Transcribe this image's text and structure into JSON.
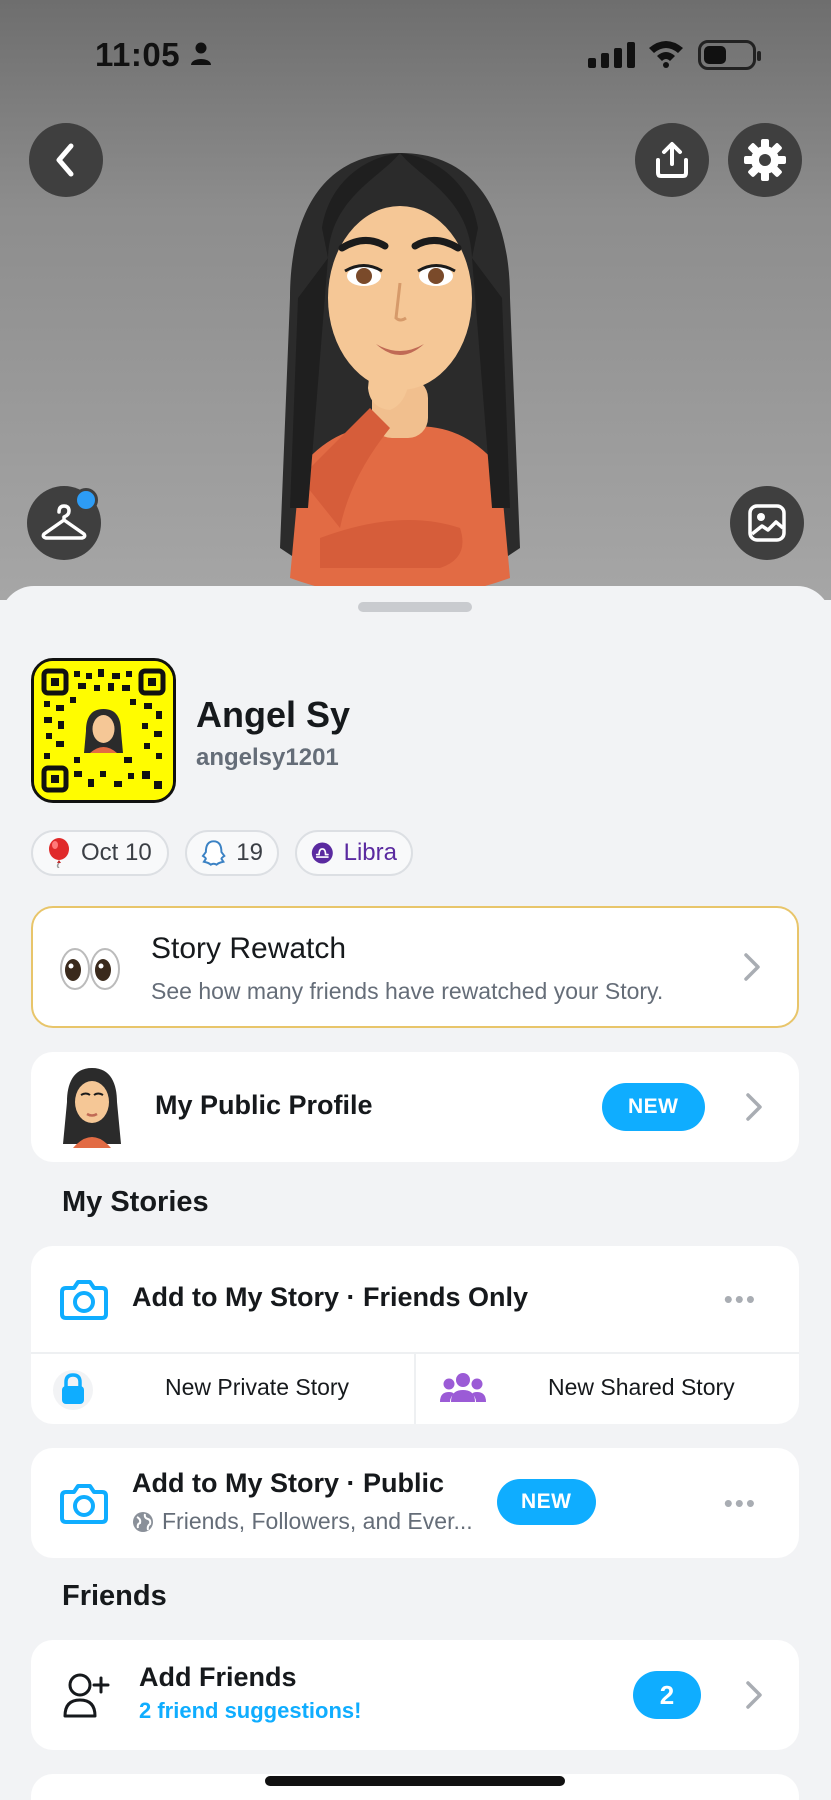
{
  "status_bar": {
    "time": "11:05"
  },
  "profile": {
    "name": "Angel Sy",
    "username": "angelsy1201"
  },
  "chips": {
    "birthday": "Oct 10",
    "snap_score": "19",
    "zodiac": "Libra"
  },
  "story_rewatch": {
    "title": "Story Rewatch",
    "subtitle": "See how many friends have rewatched your Story."
  },
  "public_profile": {
    "label": "My Public Profile",
    "badge": "NEW"
  },
  "my_stories": {
    "section_title": "My Stories",
    "friends_only": "Add to My Story · Friends Only",
    "new_private": "New Private Story",
    "new_shared": "New Shared Story",
    "public_title": "Add to My Story · Public",
    "public_subtitle": "Friends, Followers, and Ever...",
    "public_badge": "NEW",
    "more_glyph": "•••"
  },
  "friends": {
    "section_title": "Friends",
    "add_title": "Add Friends",
    "add_subtitle": "2 friend suggestions!",
    "count": "2"
  },
  "colors": {
    "accent_blue": "#0fadff",
    "snapcode_yellow": "#fffc00",
    "libra_purple": "#5a2aa0",
    "rewatch_border": "#e8c56a"
  },
  "icons": [
    "back-icon",
    "share-icon",
    "gear-icon",
    "hanger-icon",
    "image-icon",
    "balloon-icon",
    "ghost-icon",
    "libra-icon",
    "eyes-icon",
    "camera-icon",
    "lock-icon",
    "group-icon",
    "globe-icon",
    "add-friend-icon",
    "chevron-right-icon"
  ]
}
